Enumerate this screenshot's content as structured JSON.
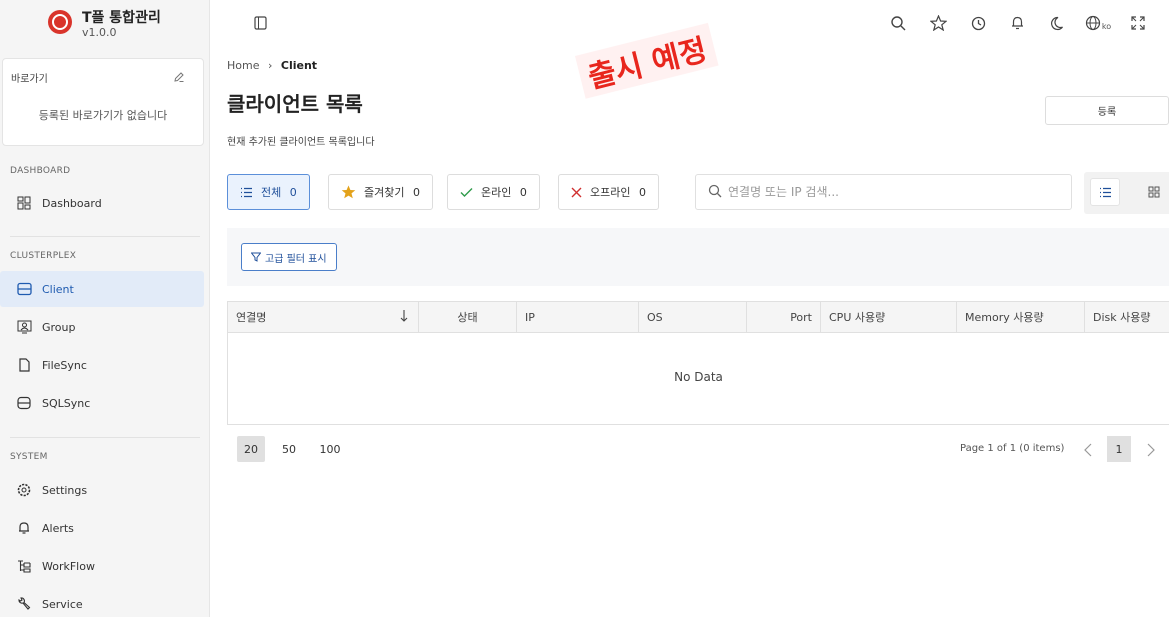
{
  "app": {
    "title": "T플 통합관리",
    "version": "v1.0.0"
  },
  "shortcut": {
    "title": "바로가기",
    "empty_text": "등록된 바로가기가 없습니다"
  },
  "sidebar": {
    "sections": [
      {
        "label": "DASHBOARD",
        "items": [
          {
            "label": "Dashboard",
            "icon": "dashboard-grid-icon"
          }
        ]
      },
      {
        "label": "CLUSTERPLEX",
        "items": [
          {
            "label": "Client",
            "icon": "server-icon",
            "active": true
          },
          {
            "label": "Group",
            "icon": "group-icon"
          },
          {
            "label": "FileSync",
            "icon": "file-icon"
          },
          {
            "label": "SQLSync",
            "icon": "database-icon"
          }
        ]
      },
      {
        "label": "SYSTEM",
        "items": [
          {
            "label": "Settings",
            "icon": "gear-icon"
          },
          {
            "label": "Alerts",
            "icon": "bell-icon"
          },
          {
            "label": "WorkFlow",
            "icon": "workflow-icon"
          },
          {
            "label": "Service",
            "icon": "wrench-icon"
          }
        ]
      }
    ]
  },
  "header": {
    "lang_code": "ko"
  },
  "breadcrumb": {
    "home": "Home",
    "separator": "›",
    "current": "Client"
  },
  "page": {
    "title": "클라이언트 목록",
    "description": "현재 추가된 클라이언트 목록입니다",
    "register_label": "등록",
    "stamp": "출시 예정"
  },
  "filters": [
    {
      "label": "전체",
      "count": "0",
      "icon": "list-icon",
      "active": true
    },
    {
      "label": "즐겨찾기",
      "count": "0",
      "icon": "star-icon"
    },
    {
      "label": "온라인",
      "count": "0",
      "icon": "check-icon"
    },
    {
      "label": "오프라인",
      "count": "0",
      "icon": "close-icon"
    }
  ],
  "search": {
    "placeholder": "연결명 또는 IP 검색..."
  },
  "advanced_filter": {
    "label": "고급 필터 표시"
  },
  "table": {
    "columns": [
      "연결명",
      "상태",
      "IP",
      "OS",
      "Port",
      "CPU 사용량",
      "Memory 사용량",
      "Disk 사용량"
    ],
    "empty": "No Data"
  },
  "pagination": {
    "sizes": [
      "20",
      "50",
      "100"
    ],
    "selected_size": "20",
    "info": "Page 1 of 1 (0 items)",
    "current_page": "1"
  },
  "colors": {
    "accent": "#1f5bb0",
    "brand": "#d9342b",
    "stamp": "#e8261d"
  }
}
